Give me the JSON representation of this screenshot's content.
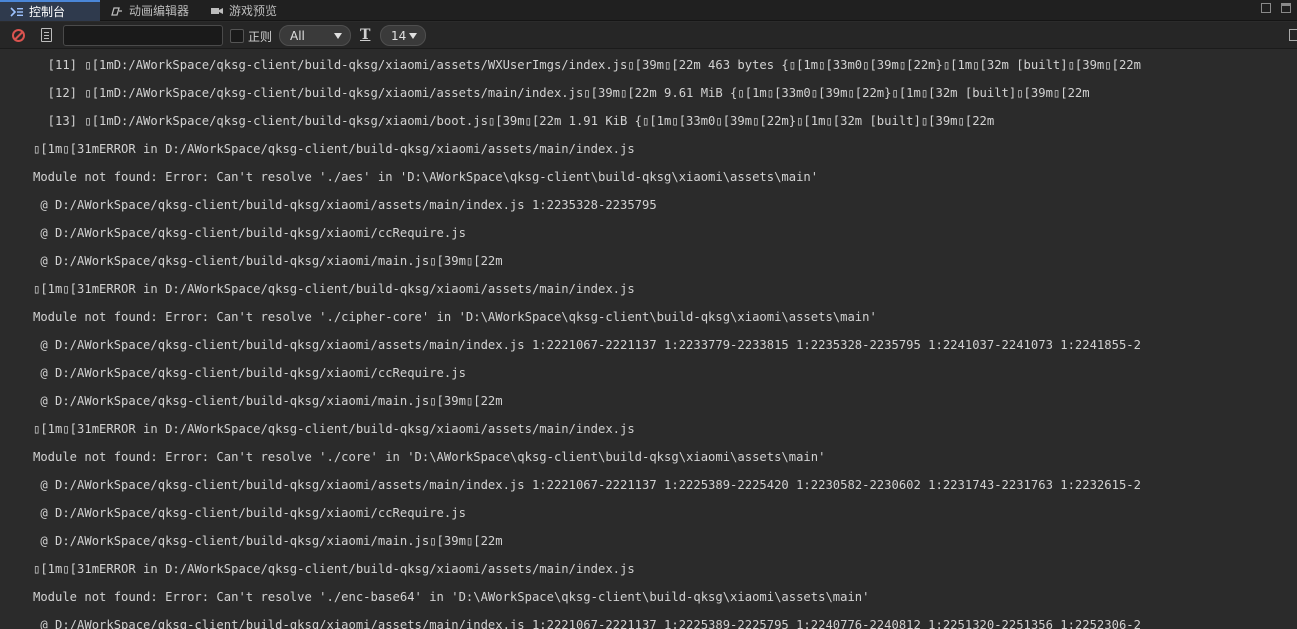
{
  "tabs": [
    {
      "label": "控制台",
      "icon": "console-icon",
      "active": true
    },
    {
      "label": "动画编辑器",
      "icon": "animation-icon",
      "active": false
    },
    {
      "label": "游戏预览",
      "icon": "camera-icon",
      "active": false
    }
  ],
  "toolbar": {
    "search_value": "",
    "regex_label": "正则",
    "filter_level": "All",
    "font_size": "14"
  },
  "log_lines": [
    "  [11] ▯[1mD:/AWorkSpace/qksg-client/build-qksg/xiaomi/assets/WXUserImgs/index.js▯[39m▯[22m 463 bytes {▯[1m▯[33m0▯[39m▯[22m}▯[1m▯[32m [built]▯[39m▯[22m",
    "  [12] ▯[1mD:/AWorkSpace/qksg-client/build-qksg/xiaomi/assets/main/index.js▯[39m▯[22m 9.61 MiB {▯[1m▯[33m0▯[39m▯[22m}▯[1m▯[32m [built]▯[39m▯[22m",
    "  [13] ▯[1mD:/AWorkSpace/qksg-client/build-qksg/xiaomi/boot.js▯[39m▯[22m 1.91 KiB {▯[1m▯[33m0▯[39m▯[22m}▯[1m▯[32m [built]▯[39m▯[22m",
    "▯[1m▯[31mERROR in D:/AWorkSpace/qksg-client/build-qksg/xiaomi/assets/main/index.js",
    "Module not found: Error: Can't resolve './aes' in 'D:\\AWorkSpace\\qksg-client\\build-qksg\\xiaomi\\assets\\main'",
    " @ D:/AWorkSpace/qksg-client/build-qksg/xiaomi/assets/main/index.js 1:2235328-2235795",
    " @ D:/AWorkSpace/qksg-client/build-qksg/xiaomi/ccRequire.js",
    " @ D:/AWorkSpace/qksg-client/build-qksg/xiaomi/main.js▯[39m▯[22m",
    "▯[1m▯[31mERROR in D:/AWorkSpace/qksg-client/build-qksg/xiaomi/assets/main/index.js",
    "Module not found: Error: Can't resolve './cipher-core' in 'D:\\AWorkSpace\\qksg-client\\build-qksg\\xiaomi\\assets\\main'",
    " @ D:/AWorkSpace/qksg-client/build-qksg/xiaomi/assets/main/index.js 1:2221067-2221137 1:2233779-2233815 1:2235328-2235795 1:2241037-2241073 1:2241855-2",
    " @ D:/AWorkSpace/qksg-client/build-qksg/xiaomi/ccRequire.js",
    " @ D:/AWorkSpace/qksg-client/build-qksg/xiaomi/main.js▯[39m▯[22m",
    "▯[1m▯[31mERROR in D:/AWorkSpace/qksg-client/build-qksg/xiaomi/assets/main/index.js",
    "Module not found: Error: Can't resolve './core' in 'D:\\AWorkSpace\\qksg-client\\build-qksg\\xiaomi\\assets\\main'",
    " @ D:/AWorkSpace/qksg-client/build-qksg/xiaomi/assets/main/index.js 1:2221067-2221137 1:2225389-2225420 1:2230582-2230602 1:2231743-2231763 1:2232615-2",
    " @ D:/AWorkSpace/qksg-client/build-qksg/xiaomi/ccRequire.js",
    " @ D:/AWorkSpace/qksg-client/build-qksg/xiaomi/main.js▯[39m▯[22m",
    "▯[1m▯[31mERROR in D:/AWorkSpace/qksg-client/build-qksg/xiaomi/assets/main/index.js",
    "Module not found: Error: Can't resolve './enc-base64' in 'D:\\AWorkSpace\\qksg-client\\build-qksg\\xiaomi\\assets\\main'",
    " @ D:/AWorkSpace/qksg-client/build-qksg/xiaomi/assets/main/index.js 1:2221067-2221137 1:2225389-2225795 1:2240776-2240812 1:2251320-2251356 1:2252306-2"
  ],
  "colors": {
    "background": "#2b2b2b",
    "tab_active": "#2f3a4d",
    "accent": "#4a86d8",
    "clear_icon": "#d9534f"
  }
}
